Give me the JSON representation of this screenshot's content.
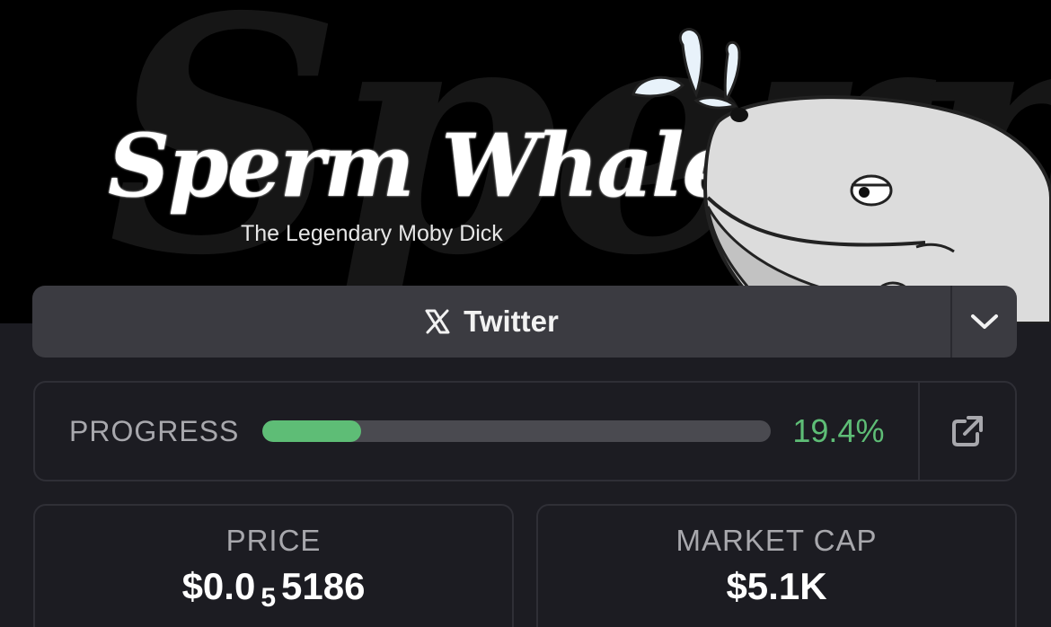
{
  "banner": {
    "title": "Sperm Whale",
    "subtitle": "The Legendary Moby Dick",
    "watermark": "Sperm"
  },
  "social": {
    "icon": "x-logo-icon",
    "label": "Twitter",
    "toggle_icon": "chevron-down-icon"
  },
  "progress": {
    "label": "PROGRESS",
    "percent": 19.4,
    "value_text": "19.4%",
    "fill_color": "#5ebd76",
    "link_icon": "external-link-icon"
  },
  "stats": {
    "price": {
      "label": "PRICE",
      "value_prefix": "$0.0",
      "value_subscript": "5",
      "value_suffix": "5186"
    },
    "market_cap": {
      "label": "MARKET CAP",
      "value": "$5.1K"
    }
  },
  "colors": {
    "background": "#1c1c22",
    "banner": "#000000",
    "accent_green": "#5ebd76",
    "button_bg": "#3b3b41"
  }
}
